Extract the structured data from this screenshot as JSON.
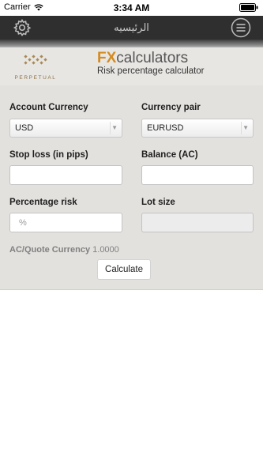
{
  "status_bar": {
    "carrier": "Carrier",
    "time": "3:34 AM",
    "wifi_icon": "wifi-icon",
    "battery_icon": "battery-icon"
  },
  "nav": {
    "title": "الرئيسيه",
    "settings_icon": "gear-icon",
    "menu_icon": "hamburger-menu-icon"
  },
  "header": {
    "logo_text": "PERPETUAL",
    "brand_fx": "FX",
    "brand_calculators": "calculators",
    "subtitle": "Risk percentage calculator"
  },
  "form": {
    "account_currency": {
      "label": "Account Currency",
      "value": "USD"
    },
    "currency_pair": {
      "label": "Currency pair",
      "value": "EURUSD"
    },
    "stop_loss": {
      "label": "Stop loss (in pips)",
      "value": ""
    },
    "balance": {
      "label": "Balance (AC)",
      "value": ""
    },
    "percentage_risk": {
      "label": "Percentage risk",
      "placeholder": "%"
    },
    "lot_size": {
      "label": "Lot size",
      "value": ""
    },
    "rate": {
      "label": "AC/Quote Currency",
      "value": "1.0000"
    },
    "calculate_label": "Calculate"
  },
  "colors": {
    "nav_bar": "#2f2f2f",
    "panel": "#e3e1de",
    "brand_accent": "#d48b1f",
    "logo_gold": "#8c7244"
  }
}
